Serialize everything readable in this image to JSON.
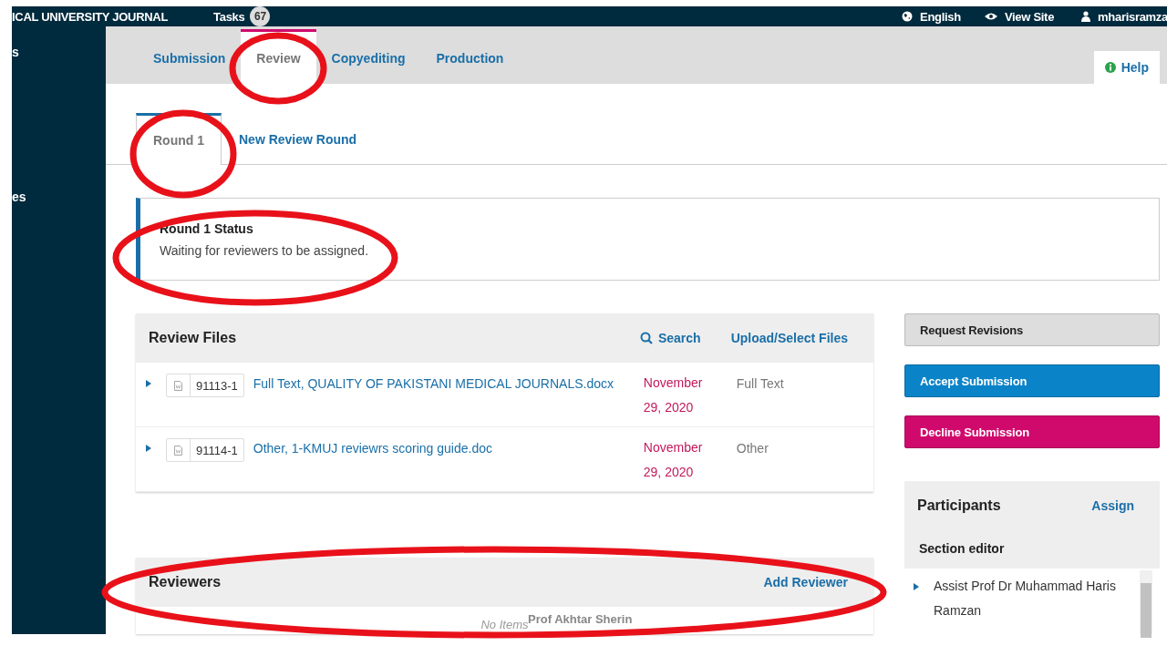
{
  "header": {
    "journal_title": "ICAL UNIVERSITY JOURNAL",
    "tasks_label": "Tasks",
    "tasks_count": "67",
    "language": "English",
    "view_site": "View Site",
    "username": "mharisramza"
  },
  "sidebar": {
    "items": [
      "s",
      "es"
    ]
  },
  "stage_tabs": [
    {
      "label": "Submission",
      "selected": false
    },
    {
      "label": "Review",
      "selected": true
    },
    {
      "label": "Copyediting",
      "selected": false
    },
    {
      "label": "Production",
      "selected": false
    }
  ],
  "help": "Help",
  "round_tabs": [
    {
      "label": "Round 1",
      "selected": true
    },
    {
      "label": "New Review Round",
      "selected": false
    }
  ],
  "round_status": {
    "title": "Round 1 Status",
    "message": "Waiting for reviewers to be assigned."
  },
  "review_files": {
    "title": "Review Files",
    "search": "Search",
    "upload": "Upload/Select Files",
    "rows": [
      {
        "id": "91113-1",
        "name": "Full Text, QUALITY OF PAKISTANI MEDICAL JOURNALS.docx",
        "date": "November 29, 2020",
        "type": "Full Text"
      },
      {
        "id": "91114-1",
        "name": "Other, 1-KMUJ reviewrs scoring guide.doc",
        "date": "November 29, 2020",
        "type": "Other"
      }
    ]
  },
  "actions": [
    {
      "label": "Request Revisions",
      "kind": "default"
    },
    {
      "label": "Accept Submission",
      "kind": "accept"
    },
    {
      "label": "Decline Submission",
      "kind": "decline"
    }
  ],
  "participants": {
    "title": "Participants",
    "assign": "Assign",
    "groups": [
      {
        "title": "Section editor",
        "members": [
          "Assist Prof Dr Muhammad Haris Ramzan"
        ]
      }
    ]
  },
  "reviewers": {
    "title": "Reviewers",
    "add": "Add Reviewer",
    "empty": "No Items"
  },
  "overlay_caption": "Prof Akhtar Sherin"
}
